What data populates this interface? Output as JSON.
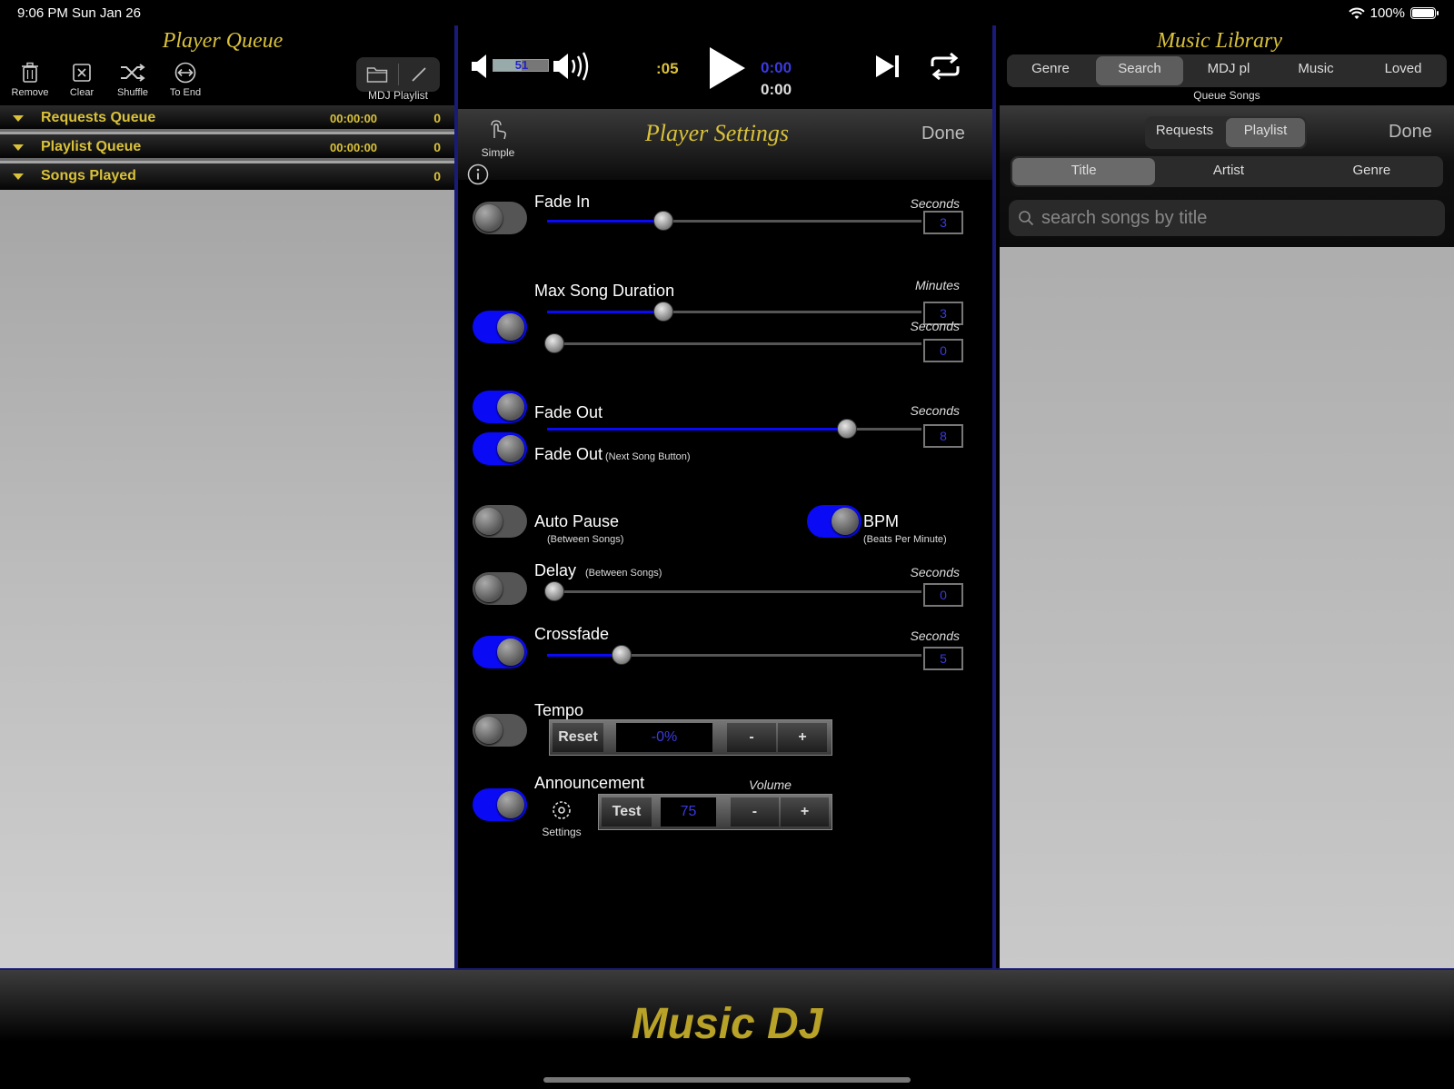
{
  "status": {
    "time": "9:06 PM  Sun Jan 26",
    "battery": "100%"
  },
  "left": {
    "title": "Player Queue",
    "tools": [
      "Remove",
      "Clear",
      "Shuffle",
      "To End"
    ],
    "playlist_label": "MDJ Playlist",
    "queues": [
      {
        "label": "Requests Queue",
        "duration": "00:00:00",
        "count": "0"
      },
      {
        "label": "Playlist Queue",
        "duration": "00:00:00",
        "count": "0"
      },
      {
        "label": "Songs Played",
        "duration": "",
        "count": "0"
      }
    ]
  },
  "transport": {
    "volume": "51",
    "countdown": ":05",
    "elapsed": "0:00",
    "total": "0:00"
  },
  "settings": {
    "mode_label": "Simple",
    "title": "Player Settings",
    "done": "Done",
    "fade_in": {
      "label": "Fade In",
      "unit": "Seconds",
      "value": "3",
      "enabled": false,
      "level": 0.31
    },
    "max_song": {
      "label": "Max Song Duration",
      "unit_min": "Minutes",
      "minutes": "3",
      "unit_sec": "Seconds",
      "seconds": "0",
      "enabled": true,
      "level_min": 0.31,
      "level_sec": 0.02
    },
    "fade_out": {
      "label": "Fade Out",
      "unit": "Seconds",
      "value": "8",
      "enabled": true,
      "level": 0.8
    },
    "fade_out_next": {
      "label": "Fade Out",
      "sub": "(Next Song Button)",
      "enabled": true
    },
    "auto_pause": {
      "label": "Auto Pause",
      "sub": "(Between Songs)",
      "enabled": false
    },
    "bpm": {
      "label": "BPM",
      "sub": "(Beats Per Minute)",
      "enabled": true
    },
    "delay": {
      "label": "Delay",
      "sub": "(Between Songs)",
      "unit": "Seconds",
      "value": "0",
      "enabled": false,
      "level": 0.02
    },
    "crossfade": {
      "label": "Crossfade",
      "unit": "Seconds",
      "value": "5",
      "enabled": true,
      "level": 0.2
    },
    "tempo": {
      "label": "Tempo",
      "reset": "Reset",
      "value": "-0%",
      "minus": "-",
      "plus": "+",
      "enabled": false
    },
    "announcement": {
      "label": "Announcement",
      "settings": "Settings",
      "volume_label": "Volume",
      "test": "Test",
      "value": "75",
      "minus": "-",
      "plus": "+",
      "enabled": true
    }
  },
  "right": {
    "title": "Music Library",
    "tabs": [
      "Genre",
      "Search",
      "MDJ pl",
      "Music",
      "Loved"
    ],
    "selected_tab": "Search",
    "queue_songs": "Queue Songs",
    "source_tabs": [
      "Requests",
      "Playlist"
    ],
    "done": "Done",
    "field_tabs": [
      "Title",
      "Artist",
      "Genre"
    ],
    "search_placeholder": "search songs by title"
  },
  "footer": {
    "brand": "Music DJ"
  }
}
